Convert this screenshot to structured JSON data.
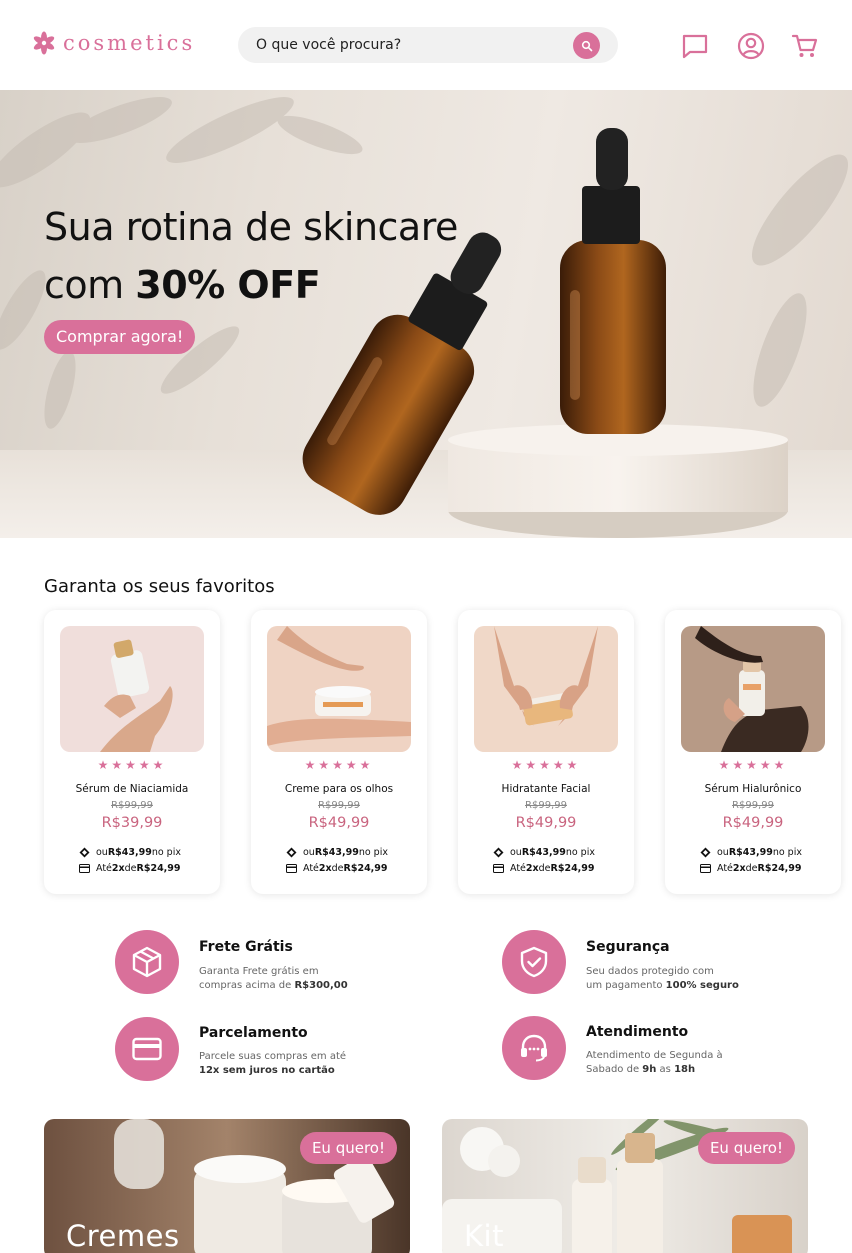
{
  "header": {
    "logo_text": "cosmetics",
    "search_placeholder": "O que você procura?",
    "icons": [
      "chat-icon",
      "user-icon",
      "cart-icon"
    ]
  },
  "hero": {
    "title_line1": "Sua rotina de skincare",
    "title_line2_prefix": "com ",
    "title_line2_bold": "30% OFF",
    "cta_label": "Comprar agora!"
  },
  "favorites": {
    "title": "Garanta os seus favoritos",
    "stars_rating": 5,
    "stars": "★★★★★",
    "products": [
      {
        "name": "Sérum de Niaciamida",
        "old_price": "R$99,99",
        "price": "R$39,99",
        "pix_prefix": "ou ",
        "pix_price": "R$43,99",
        "pix_suffix": " no pix",
        "inst_prefix": "Até ",
        "inst_count": "2x",
        "inst_mid": " de ",
        "inst_value": "R$24,99"
      },
      {
        "name": "Creme para os olhos",
        "old_price": "R$99,99",
        "price": "R$49,99",
        "pix_prefix": "ou ",
        "pix_price": "R$43,99",
        "pix_suffix": " no pix",
        "inst_prefix": "Até ",
        "inst_count": "2x",
        "inst_mid": " de ",
        "inst_value": "R$24,99"
      },
      {
        "name": "Hidratante Facial",
        "old_price": "R$99,99",
        "price": "R$49,99",
        "pix_prefix": "ou ",
        "pix_price": "R$43,99",
        "pix_suffix": " no pix",
        "inst_prefix": "Até ",
        "inst_count": "2x",
        "inst_mid": " de ",
        "inst_value": "R$24,99"
      },
      {
        "name": "Sérum Hialurônico",
        "old_price": "R$99,99",
        "price": "R$49,99",
        "pix_prefix": "ou ",
        "pix_price": "R$43,99",
        "pix_suffix": " no pix",
        "inst_prefix": "Até ",
        "inst_count": "2x",
        "inst_mid": " de ",
        "inst_value": "R$24,99"
      }
    ]
  },
  "features": [
    {
      "title": "Frete Grátis",
      "line1": "Garanta Frete grátis em",
      "line2_prefix": "compras acima de ",
      "line2_bold": "R$300,00",
      "icon": "box-icon"
    },
    {
      "title": "Segurança",
      "line1": "Seu dados protegido com",
      "line2_prefix": "um pagamento ",
      "line2_bold": "100% seguro",
      "icon": "shield-check-icon"
    },
    {
      "title": "Parcelamento",
      "line1": "Parcele suas compras em até",
      "line2_prefix": "",
      "line2_bold": "12x sem juros no cartão",
      "icon": "credit-card-icon"
    },
    {
      "title": "Atendimento",
      "line1": "Atendimento de Segunda à",
      "line2_prefix": "Sabado de ",
      "line2_bold": "9h",
      "line2_mid": " as ",
      "line2_bold2": "18h",
      "icon": "headset-icon"
    }
  ],
  "promos": [
    {
      "label": "Cremes",
      "cta": "Eu quero!"
    },
    {
      "label": "Kit",
      "cta": "Eu quero!"
    }
  ],
  "colors": {
    "accent": "#d9709a",
    "price": "#c9647f"
  }
}
